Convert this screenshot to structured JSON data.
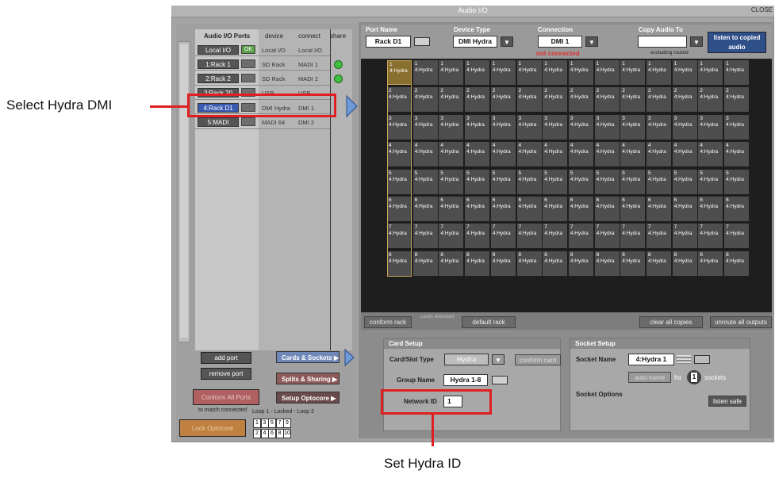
{
  "window": {
    "title": "Audio I/O",
    "close_label": "CLOSE"
  },
  "ports_header": {
    "ports": "Audio I/O Ports",
    "device": "device",
    "connect": "connect",
    "share": "share"
  },
  "ports": [
    {
      "label": "Local I/O",
      "check": "OK",
      "device": "Local I/O",
      "connect": "Local I/O",
      "share": false
    },
    {
      "label": "1:Rack 1",
      "check": "",
      "device": "SD Rack",
      "connect": "MADI 1",
      "share": true
    },
    {
      "label": "2:Rack 2",
      "check": "",
      "device": "SD Rack",
      "connect": "MADI 2",
      "share": true
    },
    {
      "label": "3:Rack 20",
      "check": "",
      "device": "USB",
      "connect": "USB",
      "share": false
    },
    {
      "label": "4:Rack D1",
      "check": "",
      "device": "DMI Hydra",
      "connect": "DMI 1",
      "share": false
    },
    {
      "label": "5:MADI",
      "check": "",
      "device": "MADI 64",
      "connect": "DMI 2",
      "share": false
    }
  ],
  "left_buttons": {
    "add_port": "add port",
    "remove_port": "remove port",
    "conform_all": "Conform All Ports",
    "match_connected": "to match connected",
    "lock_optocore": "Lock Optocore",
    "loop_status": "Loop 1 - Locked - Loop 2"
  },
  "loop_numbers_top": [
    "1",
    "3",
    "5",
    "7",
    "9"
  ],
  "loop_numbers_bottom": [
    "2",
    "4",
    "6",
    "8",
    "10"
  ],
  "tabs": {
    "cards_sockets": "Cards & Sockets",
    "splits_sharing": "Splits & Sharing",
    "setup_optocore": "Setup Optocore"
  },
  "port": {
    "name_label": "Port Name",
    "name": "Rack D1",
    "type_label": "Device Type",
    "type": "DMI Hydra",
    "conn_label": "Connection",
    "conn": "DMI 1",
    "conn_status": "not connected",
    "copy_label": "Copy Audio To",
    "copy_note": "excluding routed",
    "listen_label": "listen to copied audio"
  },
  "grid_cell_text": "4:Hydra",
  "grid_rows": [
    "1",
    "2",
    "3",
    "4",
    "5",
    "6",
    "7",
    "8"
  ],
  "grid_cols": 14,
  "bottom_bar": {
    "conform_rack": "conform rack",
    "cards_detected": "cards detected",
    "default_rack": "default rack",
    "clear_copies": "clear all copies",
    "unroute": "unroute all outputs"
  },
  "card_setup": {
    "header": "Card Setup",
    "slot_label": "Card/Slot Type",
    "slot_value": "Hydra",
    "conform_card": "conform card",
    "group_label": "Group Name",
    "group_value": "Hydra 1-8",
    "network_label": "Network ID",
    "network_value": "1"
  },
  "socket_setup": {
    "header": "Socket Setup",
    "name_label": "Socket Name",
    "name_value": "4:Hydra 1",
    "auto_name": "auto-name",
    "for_label": "for",
    "count": "1",
    "sockets_label": "sockets",
    "options_label": "Socket Options",
    "listen_safe": "listen safe"
  },
  "annotations": {
    "select": "Select Hydra DMI",
    "set_id": "Set Hydra ID"
  }
}
